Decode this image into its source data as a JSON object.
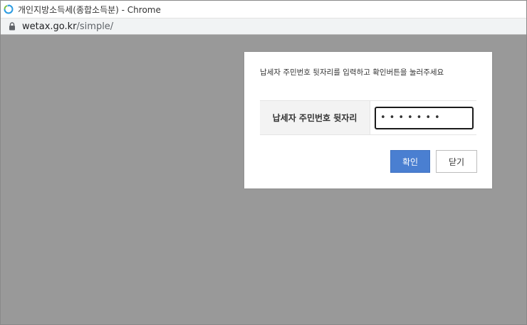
{
  "window": {
    "title": "개인지방소득세(종합소득분) - Chrome",
    "icon": "wetax-refresh-icon"
  },
  "address_bar": {
    "host": "wetax.go.kr",
    "path": "/simple/",
    "icon": "lock-icon"
  },
  "dialog": {
    "message": "납세자 주민번호 뒷자리를 입력하고 확인버튼을 눌러주세요",
    "field_label": "납세자 주민번호 뒷자리",
    "field_value": "•••••••",
    "confirm_label": "확인",
    "close_label": "닫기"
  },
  "colors": {
    "overlay": "#999999",
    "confirm_button": "#4a7fd1",
    "label_cell_bg": "#f3f3f3"
  }
}
